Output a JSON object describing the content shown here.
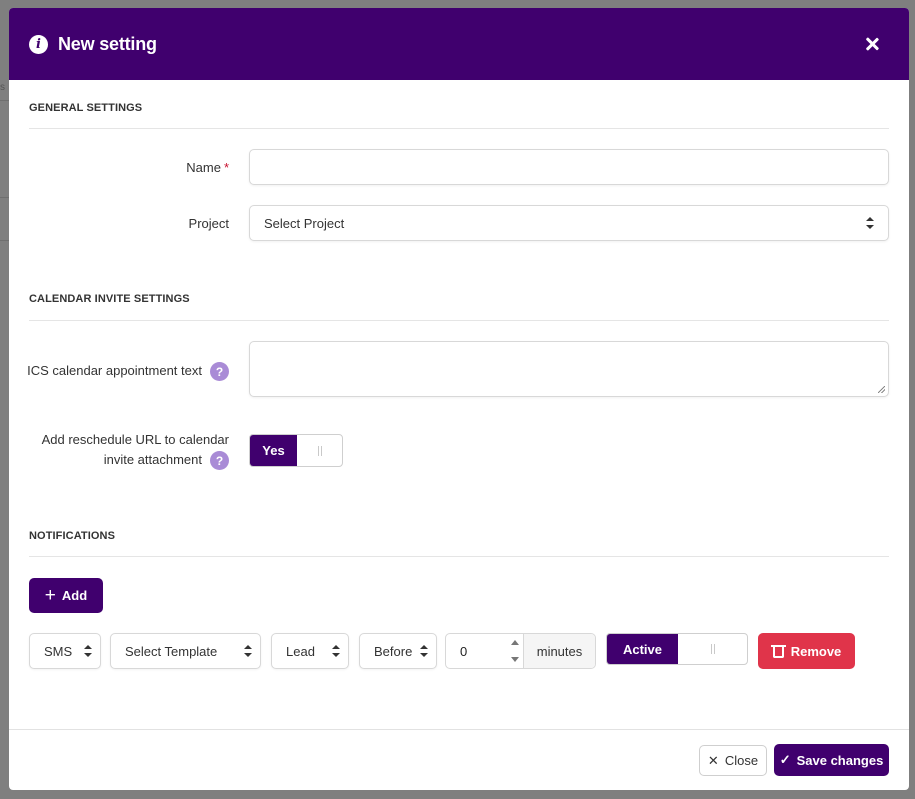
{
  "backdrop": {
    "fragment": "s"
  },
  "modal": {
    "title": "New setting",
    "header_color": "#40006e",
    "sections": {
      "general": "GENERAL SETTINGS",
      "calendar": "CALENDAR INVITE SETTINGS",
      "notifications": "NOTIFICATIONS"
    },
    "fields": {
      "name": {
        "label": "Name",
        "required_mark": "*",
        "value": ""
      },
      "project": {
        "label": "Project",
        "selected": "Select Project"
      },
      "ics_text": {
        "label": "ICS calendar appointment text",
        "value": ""
      },
      "reschedule_url": {
        "label_line1": "Add reschedule URL to calendar",
        "label_line2": "invite attachment",
        "toggle_on_label": "Yes",
        "enabled": true
      }
    },
    "notifications": {
      "add_label": "Add",
      "row": {
        "channel": "SMS",
        "template": "Select Template",
        "recipient": "Lead",
        "timing": "Before",
        "offset_value": "0",
        "offset_unit": "minutes",
        "status_label": "Active",
        "status_active": true,
        "remove_label": "Remove"
      }
    },
    "footer": {
      "close_label": "Close",
      "save_label": "Save changes"
    },
    "colors": {
      "accent": "#40006e",
      "danger": "#e0344a",
      "help": "#a98bd6"
    }
  }
}
